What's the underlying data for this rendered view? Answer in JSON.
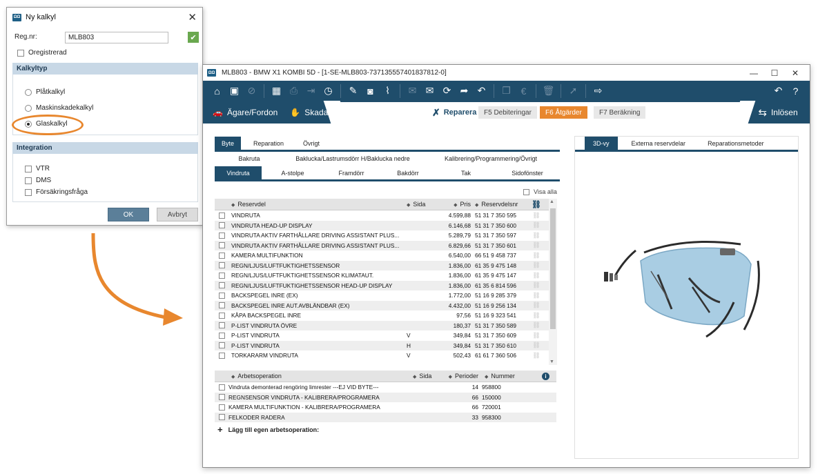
{
  "dialog": {
    "title": "Ny kalkyl",
    "reg_label": "Reg.nr:",
    "reg_value": "MLB803",
    "oregistrerad": "Oregistrerad",
    "kalkyltyp_header": "Kalkyltyp",
    "radios": [
      {
        "label": "Plåtkalkyl",
        "selected": false
      },
      {
        "label": "Maskinskadekalkyl",
        "selected": false
      },
      {
        "label": "Glaskalkyl",
        "selected": true
      }
    ],
    "integration_header": "Integration",
    "integration": [
      "VTR",
      "DMS",
      "Försäkringsfråga"
    ],
    "ok": "OK",
    "cancel": "Avbryt"
  },
  "window": {
    "title": "MLB803 - BMW X1 KOMBI 5D - [1-SE-MLB803-737135557401837812-0]",
    "logo": "ΩΩ",
    "minimize": "—",
    "maximize": "☐",
    "close": "✕"
  },
  "nav": {
    "owner": "Ägare/Fordon",
    "damage": "Skada",
    "repair": "Reparera",
    "step_deb": "F5  Debiteringar",
    "step_atg": "F6  Åtgärder",
    "step_ber": "F7  Beräkning",
    "release": "Inlösen"
  },
  "tabs": [
    "Byte",
    "Reparation",
    "Övrigt"
  ],
  "subtabs_top": [
    "Bakruta",
    "Baklucka/Lastrumsdörr H/Baklucka nedre",
    "Kalibrering/Programmering/Övrigt"
  ],
  "subtabs": [
    "Vindruta",
    "A-stolpe",
    "Framdörr",
    "Bakdörr",
    "Tak",
    "Sidofönster"
  ],
  "visa_alla": "Visa alla",
  "parts_header": {
    "name": "Reservdel",
    "sida": "Sida",
    "pris": "Pris",
    "nr": "Reservdelsnr"
  },
  "parts": [
    {
      "name": "VINDRUTA",
      "sida": "",
      "pris": "4.599,88",
      "nr": "51 31 7 350 595"
    },
    {
      "name": "VINDRUTA HEAD-UP DISPLAY",
      "sida": "",
      "pris": "6.146,68",
      "nr": "51 31 7 350 600"
    },
    {
      "name": "VINDRUTA AKTIV FARTHÅLLARE DRIVING ASSISTANT PLUS...",
      "sida": "",
      "pris": "5.289,79",
      "nr": "51 31 7 350 597"
    },
    {
      "name": "VINDRUTA AKTIV FARTHÅLLARE DRIVING ASSISTANT PLUS...",
      "sida": "",
      "pris": "6.829,66",
      "nr": "51 31 7 350 601"
    },
    {
      "name": "KAMERA MULTIFUNKTION",
      "sida": "",
      "pris": "6.540,00",
      "nr": "66 51 9 458 737"
    },
    {
      "name": "REGN/LJUS/LUFTFUKTIGHETSSENSOR",
      "sida": "",
      "pris": "1.836,00",
      "nr": "61 35 9 475 148"
    },
    {
      "name": "REGN/LJUS/LUFTFUKTIGHETSSENSOR KLIMATAUT.",
      "sida": "",
      "pris": "1.836,00",
      "nr": "61 35 9 475 147"
    },
    {
      "name": "REGN/LJUS/LUFTFUKTIGHETSSENSOR HEAD-UP DISPLAY",
      "sida": "",
      "pris": "1.836,00",
      "nr": "61 35 6 814 596"
    },
    {
      "name": "BACKSPEGEL INRE (EX)",
      "sida": "",
      "pris": "1.772,00",
      "nr": "51 16 9 285 379"
    },
    {
      "name": "BACKSPEGEL INRE AUT.AVBLÄNDBAR (EX)",
      "sida": "",
      "pris": "4.432,00",
      "nr": "51 16 9 256 134"
    },
    {
      "name": "KÅPA BACKSPEGEL INRE",
      "sida": "",
      "pris": "97,56",
      "nr": "51 16 9 323 541"
    },
    {
      "name": "P-LIST VINDRUTA ÖVRE",
      "sida": "",
      "pris": "180,37",
      "nr": "51 31 7 350 589"
    },
    {
      "name": "P-LIST VINDRUTA",
      "sida": "V",
      "pris": "349,84",
      "nr": "51 31 7 350 609"
    },
    {
      "name": "P-LIST VINDRUTA",
      "sida": "H",
      "pris": "349,84",
      "nr": "51 31 7 350 610"
    },
    {
      "name": "TORKARARM VINDRUTA",
      "sida": "V",
      "pris": "502,43",
      "nr": "61 61 7 360 506"
    }
  ],
  "ops_header": {
    "name": "Arbetsoperation",
    "sida": "Sida",
    "per": "Perioder",
    "num": "Nummer"
  },
  "ops": [
    {
      "name": "Vindruta demonterad rengöring limrester ---EJ VID BYTE---",
      "sida": "",
      "per": "14",
      "num": "958800"
    },
    {
      "name": "REGNSENSOR VINDRUTA - KALIBRERA/PROGRAMERA",
      "sida": "",
      "per": "66",
      "num": "150000"
    },
    {
      "name": "KAMERA MULTIFUNKTION - KALIBRERA/PROGRAMERA",
      "sida": "",
      "per": "66",
      "num": "720001"
    },
    {
      "name": "FELKODER RADERA",
      "sida": "",
      "per": "33",
      "num": "958300"
    }
  ],
  "add_op": "Lägg till egen arbetsoperation:",
  "right_tabs": [
    "3D-vy",
    "Externa reservdelar",
    "Reparationsmetoder"
  ],
  "colors": {
    "primary": "#1f4d6b",
    "accent": "#e8872e",
    "ok": "#6aa84f"
  }
}
